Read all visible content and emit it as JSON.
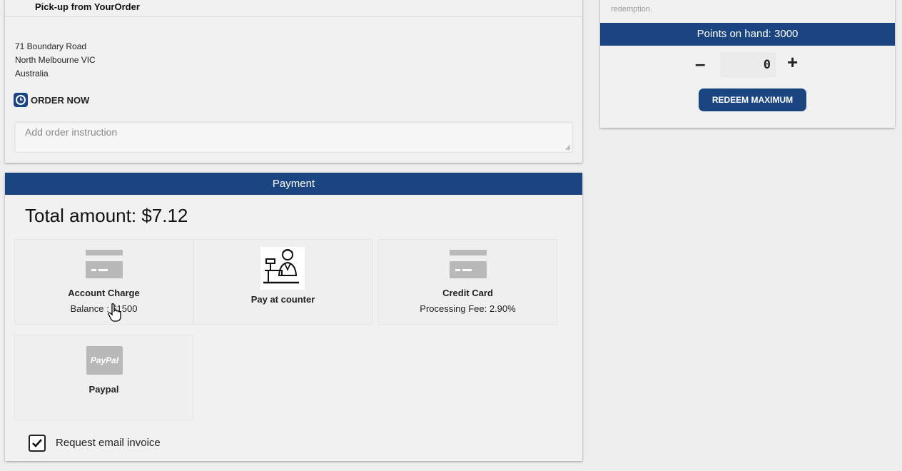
{
  "pickup": {
    "title": "Pick-up from YourOrder",
    "address": [
      "71 Boundary Road",
      "North Melbourne VIC",
      "Australia"
    ],
    "order_now": "ORDER NOW",
    "instruction_placeholder": "Add order instruction"
  },
  "points": {
    "note": "redemption.",
    "on_hand": "Points on hand: 3000",
    "minus": "–",
    "value": "0",
    "plus": "+",
    "redeem_button": "REDEEM MAXIMUM"
  },
  "payment": {
    "header": "Payment",
    "total": "Total amount: $7.12",
    "methods": [
      {
        "name": "Account Charge",
        "detail": "Balance : $1500",
        "icon": "credit-card-icon"
      },
      {
        "name": "Pay at counter",
        "detail": "",
        "icon": "cashier-icon"
      },
      {
        "name": "Credit Card",
        "detail": "Processing Fee: 2.90%",
        "icon": "credit-card-icon"
      },
      {
        "name": "Paypal",
        "detail": "",
        "icon": "paypal-icon"
      }
    ],
    "paypal_logo": "PayPal",
    "email_invoice": "Request email invoice",
    "email_invoice_checked": true
  },
  "colors": {
    "brand": "#1b4581",
    "background": "#eeeeee"
  }
}
